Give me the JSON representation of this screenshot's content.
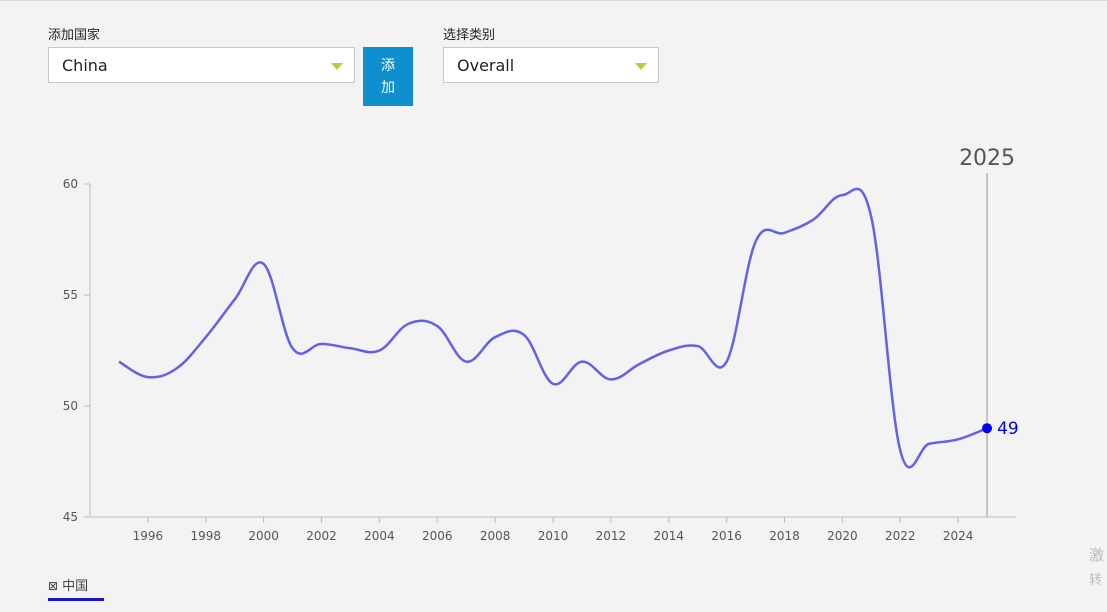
{
  "controls": {
    "country_label": "添加国家",
    "country_value": "China",
    "add_button": "添加",
    "category_label": "选择类别",
    "category_value": "Overall"
  },
  "legend": {
    "country": "中国"
  },
  "side_text": {
    "line1": "激",
    "line2": "转"
  },
  "colors": {
    "line": "#6262e8",
    "marker": "#0000ee",
    "accent_button": "#0f8fce",
    "dropdown_arrow": "#a8d63c"
  },
  "chart_data": {
    "type": "line",
    "x": [
      1995,
      1996,
      1997,
      1998,
      1999,
      2000,
      2001,
      2002,
      2003,
      2004,
      2005,
      2006,
      2007,
      2008,
      2009,
      2010,
      2011,
      2012,
      2013,
      2014,
      2015,
      2016,
      2017,
      2018,
      2019,
      2020,
      2021,
      2022,
      2023,
      2024,
      2025
    ],
    "series": [
      {
        "name": "中国",
        "values": [
          52.0,
          51.3,
          51.7,
          53.1,
          54.8,
          56.4,
          52.6,
          52.8,
          52.6,
          52.5,
          53.7,
          53.6,
          52.0,
          53.1,
          53.2,
          51.0,
          52.0,
          51.2,
          51.9,
          52.5,
          52.7,
          52.0,
          57.4,
          57.8,
          58.4,
          59.5,
          58.5,
          48.0,
          48.3,
          48.5,
          49.0
        ]
      }
    ],
    "xticks": [
      1996,
      1998,
      2000,
      2002,
      2004,
      2006,
      2008,
      2010,
      2012,
      2014,
      2016,
      2018,
      2020,
      2022,
      2024
    ],
    "yticks": [
      45,
      50,
      55,
      60
    ],
    "ylim": [
      45,
      60
    ],
    "xlim": [
      1994,
      2026
    ],
    "highlight_year": "2025",
    "highlight_value": "49",
    "grid": false
  }
}
